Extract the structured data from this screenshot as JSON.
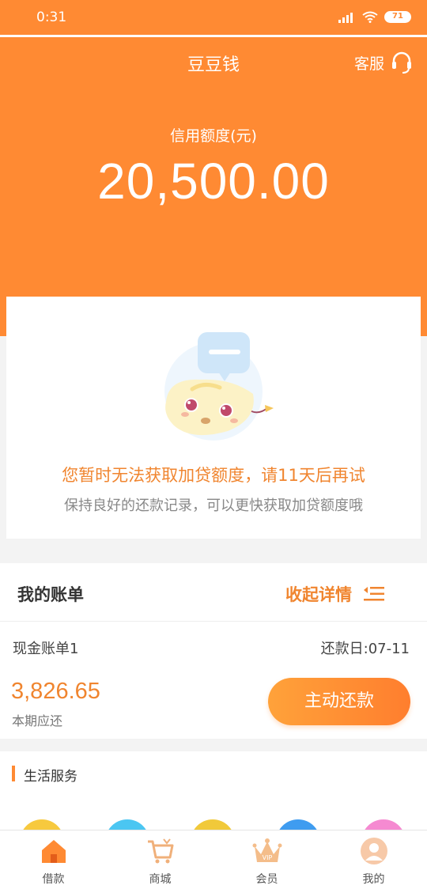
{
  "status": {
    "time": "0:31",
    "battery": "71"
  },
  "nav": {
    "title": "豆豆钱",
    "service_label": "客服"
  },
  "credit": {
    "label": "信用额度(元)",
    "amount": "20,500.00"
  },
  "notice": {
    "main": "您暂时无法获取加贷额度，请11天后再试",
    "sub": "保持良好的还款记录，可以更快获取加贷额度哦"
  },
  "bill": {
    "title": "我的账单",
    "collapse_label": "收起详情",
    "name": "现金账单1",
    "due_date": "还款日:07-11",
    "amount": "3,826.65",
    "amount_label": "本期应还",
    "repay_button": "主动还款"
  },
  "life": {
    "title": "生活服务"
  },
  "tabs": [
    {
      "label": "借款",
      "icon": "home-icon",
      "active": true
    },
    {
      "label": "商城",
      "icon": "cart-icon",
      "active": false
    },
    {
      "label": "会员",
      "icon": "crown-icon",
      "active": false
    },
    {
      "label": "我的",
      "icon": "avatar-icon",
      "active": false
    }
  ],
  "colors": {
    "brand": "#ff8a33",
    "accent_text": "#f0852f"
  }
}
